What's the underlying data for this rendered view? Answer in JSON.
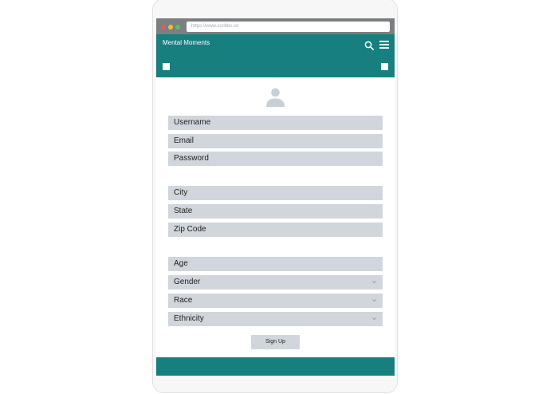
{
  "browser": {
    "url": "https://www.scribbs.io/",
    "dot_colors": [
      "#e15b5b",
      "#e8c33a",
      "#5bbf5b"
    ]
  },
  "app": {
    "title": "Mental Moments",
    "accent": "#177f7e",
    "field_bg": "#d0d6dc"
  },
  "icons": {
    "search": "search-icon",
    "menu": "hamburger-menu-icon",
    "avatar": "user-avatar-icon",
    "left_square": "square-icon",
    "right_square": "square-icon"
  },
  "form": {
    "username": "Username",
    "email": "Email",
    "password": "Password",
    "city": "City",
    "state": "State",
    "zip": "Zip Code",
    "age": "Age",
    "gender": "Gender",
    "race": "Race",
    "ethnicity": "Ethnicity",
    "submit": "Sign Up"
  }
}
